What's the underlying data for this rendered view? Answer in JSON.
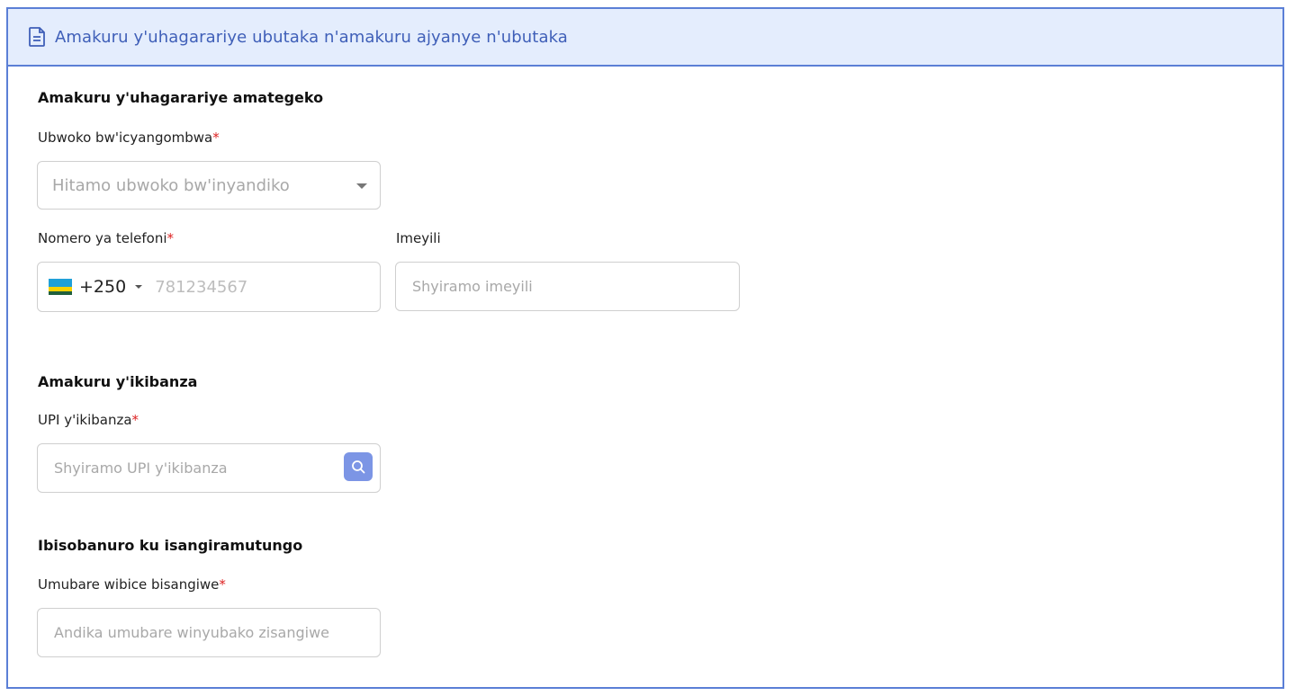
{
  "header": {
    "title": "Amakuru y'uhagarariye ubutaka n'amakuru ajyanye n'ubutaka",
    "icon": "document-icon"
  },
  "legal_rep": {
    "section_title": "Amakuru y'uhagarariye amategeko",
    "doc_type": {
      "label": "Ubwoko bw'icyangombwa",
      "required_mark": "*",
      "placeholder": "Hitamo ubwoko bw'inyandiko"
    },
    "phone": {
      "label": "Nomero ya telefoni",
      "required_mark": "*",
      "country_code": "+250",
      "placeholder": "781234567"
    },
    "email": {
      "label": "Imeyili",
      "placeholder": "Shyiramo imeyili"
    }
  },
  "plot": {
    "section_title": "Amakuru y'ikibanza",
    "upi": {
      "label": "UPI y'ikibanza",
      "required_mark": "*",
      "placeholder": "Shyiramo UPI y'ikibanza"
    }
  },
  "co_ownership": {
    "section_title": "Ibisobanuro ku isangiramutungo",
    "count": {
      "label": "Umubare wibice bisangiwe",
      "required_mark": "*",
      "placeholder": "Andika umubare winyubako zisangiwe"
    }
  },
  "colors": {
    "accent": "#5b7fd6",
    "header_bg": "#e4edfd",
    "required": "#dd2222",
    "search_button": "#7c95e5"
  }
}
